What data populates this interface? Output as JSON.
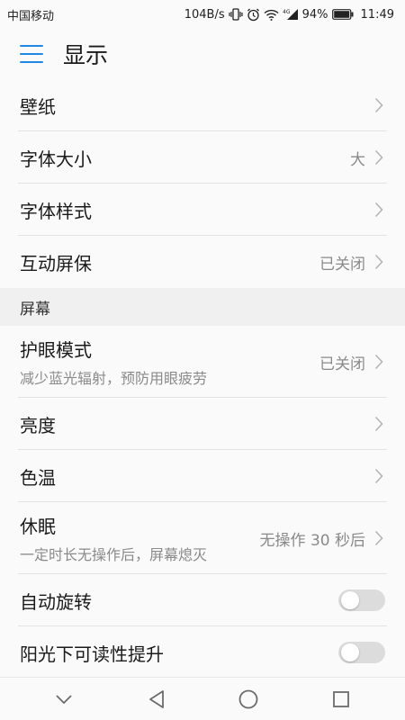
{
  "status_bar": {
    "carrier": "中国移动",
    "net_speed": "104B/s",
    "battery": "94%",
    "time": "11:49",
    "signal_tag": "4G"
  },
  "app_bar": {
    "title": "显示",
    "menu_icon": "hamburger-menu-icon"
  },
  "rows_top": [
    {
      "title": "壁纸",
      "value": ""
    },
    {
      "title": "字体大小",
      "value": "大"
    },
    {
      "title": "字体样式",
      "value": ""
    },
    {
      "title": "互动屏保",
      "value": "已关闭"
    }
  ],
  "section_screen": {
    "header": "屏幕",
    "eye_mode": {
      "title": "护眼模式",
      "subtitle": "减少蓝光辐射，预防用眼疲劳",
      "value": "已关闭"
    },
    "brightness": {
      "title": "亮度"
    },
    "color_temp": {
      "title": "色温"
    },
    "sleep": {
      "title": "休眠",
      "subtitle": "一定时长无操作后，屏幕熄灭",
      "value": "无操作 30 秒后"
    },
    "auto_rotate": {
      "title": "自动旋转",
      "enabled": false
    },
    "sunlight": {
      "title": "阳光下可读性提升",
      "enabled": false
    }
  },
  "nav_bar": {
    "icons": [
      "chevron-down-icon",
      "back-icon",
      "home-icon",
      "recents-icon"
    ]
  },
  "colors": {
    "accent": "#1e88e5",
    "divider": "#e3e3e3",
    "secondary_text": "#8a8a8a"
  }
}
